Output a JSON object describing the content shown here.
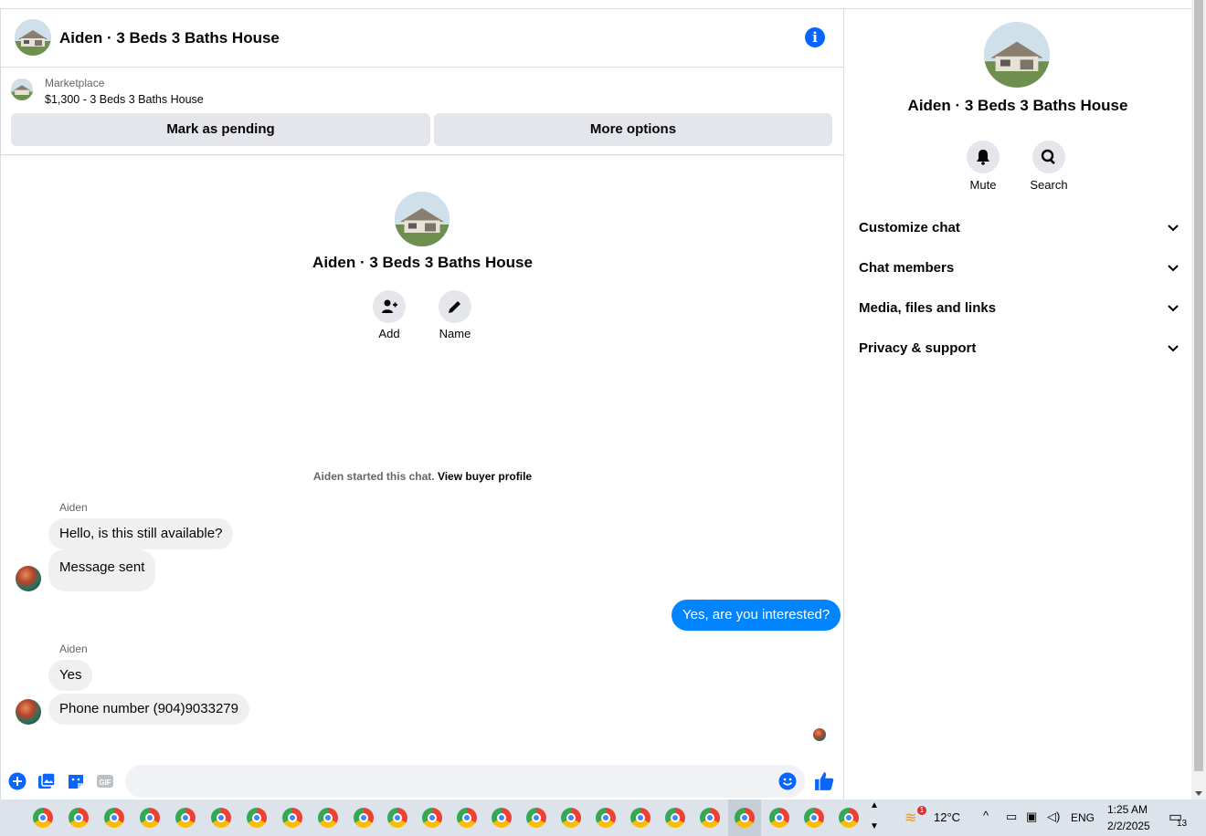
{
  "header": {
    "title": "Aiden · 3 Beds 3 Baths House",
    "info_icon": "info-icon"
  },
  "marketplace": {
    "label": "Marketplace",
    "item": "$1,300 - 3 Beds 3 Baths House",
    "mark_pending_label": "Mark as pending",
    "more_options_label": "More options"
  },
  "intro": {
    "name": "Aiden · 3 Beds 3 Baths House",
    "add_label": "Add",
    "name_label": "Name"
  },
  "started": {
    "text": "Aiden started this chat.",
    "link": "View buyer profile"
  },
  "messages": [
    {
      "sender": "Aiden",
      "texts": [
        "Hello, is this still available?",
        "Message sent"
      ]
    },
    {
      "sender": "me",
      "texts": [
        "Yes, are you interested?"
      ]
    },
    {
      "sender": "Aiden",
      "texts": [
        "Yes",
        "Phone number (904)9033279"
      ]
    }
  ],
  "composer": {
    "placeholder": ""
  },
  "side": {
    "name": "Aiden · 3 Beds 3 Baths House",
    "mute_label": "Mute",
    "search_label": "Search",
    "sections": [
      "Customize chat",
      "Chat members",
      "Media, files and links",
      "Privacy & support"
    ]
  },
  "taskbar": {
    "weather_temp": "12°C",
    "weather_badge": "1",
    "language": "ENG",
    "time": "1:25 AM",
    "date": "2/2/2025",
    "notification_count": "13"
  },
  "colors": {
    "accent": "#0866ff",
    "bubble_out": "#0084ff",
    "bubble_in": "#f0f0f0"
  }
}
